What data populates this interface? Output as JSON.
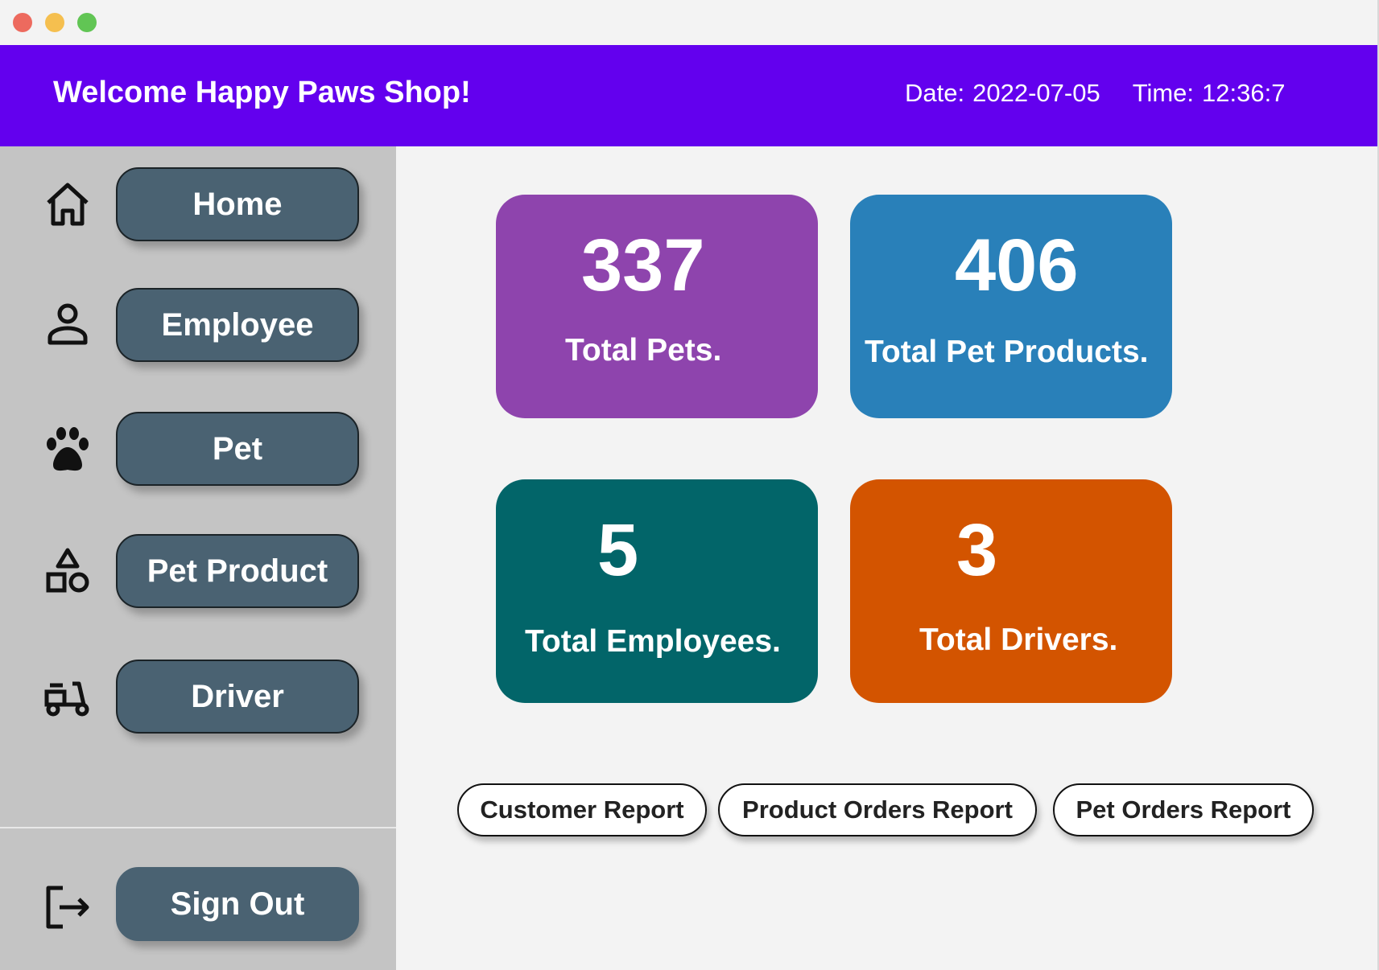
{
  "header": {
    "welcome": "Welcome Happy Paws Shop!",
    "date_label": "Date:",
    "date_value": "2022-07-05",
    "time_label": "Time:",
    "time_value": "12:36:7",
    "color": "#6300ee"
  },
  "sidebar": {
    "items": [
      {
        "label": "Home",
        "icon": "home-icon"
      },
      {
        "label": "Employee",
        "icon": "person-icon"
      },
      {
        "label": "Pet",
        "icon": "paw-icon"
      },
      {
        "label": "Pet Product",
        "icon": "shapes-icon"
      },
      {
        "label": "Driver",
        "icon": "scooter-icon"
      }
    ],
    "signout": {
      "label": "Sign Out",
      "icon": "logout-icon"
    }
  },
  "stats": [
    {
      "value": "337",
      "label": "Total Pets.",
      "color": "#8e44ad"
    },
    {
      "value": "406",
      "label": "Total Pet Products.",
      "color": "#2980b9"
    },
    {
      "value": "5",
      "label": "Total Employees.",
      "color": "#026569"
    },
    {
      "value": "3",
      "label": "Total Drivers.",
      "color": "#d35400"
    }
  ],
  "reports": [
    {
      "label": "Customer Report"
    },
    {
      "label": "Product Orders Report"
    },
    {
      "label": "Pet Orders Report"
    }
  ]
}
